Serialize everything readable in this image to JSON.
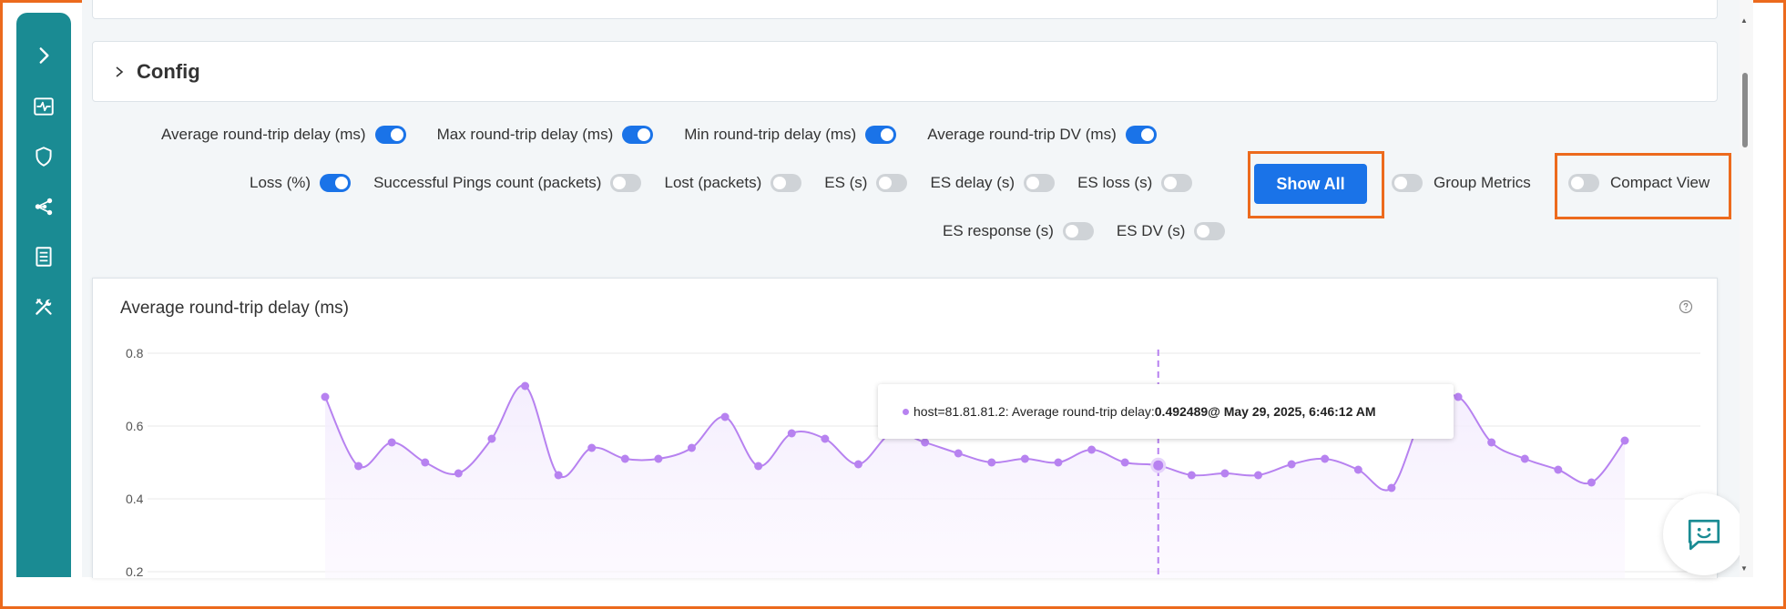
{
  "config": {
    "title": "Config"
  },
  "toggles": {
    "row1": [
      {
        "label": "Average round-trip delay (ms)",
        "on": true
      },
      {
        "label": "Max round-trip delay (ms)",
        "on": true
      },
      {
        "label": "Min round-trip delay (ms)",
        "on": true
      },
      {
        "label": "Average round-trip DV (ms)",
        "on": true
      }
    ],
    "row2": [
      {
        "label": "Loss (%)",
        "on": true
      },
      {
        "label": "Successful Pings count (packets)",
        "on": false
      },
      {
        "label": "Lost (packets)",
        "on": false
      },
      {
        "label": "ES (s)",
        "on": false
      },
      {
        "label": "ES delay (s)",
        "on": false
      },
      {
        "label": "ES loss (s)",
        "on": false
      }
    ],
    "row3": [
      {
        "label": "ES response (s)",
        "on": false
      },
      {
        "label": "ES DV (s)",
        "on": false
      }
    ]
  },
  "actions": {
    "show_all_label": "Show All",
    "group_metrics_label": "Group Metrics",
    "group_metrics_on": false,
    "compact_view_label": "Compact View",
    "compact_view_on": false
  },
  "chart": {
    "title": "Average round-trip delay (ms)",
    "tooltip": {
      "prefix": "host=81.81.81.2: Average round-trip delay: ",
      "value": "0.492489",
      "suffix": " @ May 29, 2025, 6:46:12 AM"
    },
    "colors": {
      "line": "#b782f0",
      "fill": "#f3ecfd",
      "crosshair": "#b782f0"
    }
  },
  "chart_data": {
    "type": "line",
    "title": "Average round-trip delay (ms)",
    "ylim": [
      0.2,
      0.8
    ],
    "yticks": [
      "0.8",
      "0.6",
      "0.4",
      "0.2"
    ],
    "series": [
      {
        "values": [
          0.68,
          0.49,
          0.555,
          0.5,
          0.47,
          0.565,
          0.71,
          0.465,
          0.54,
          0.51,
          0.51,
          0.54,
          0.625,
          0.49,
          0.58,
          0.565,
          0.495,
          0.58,
          0.555,
          0.525,
          0.5,
          0.51,
          0.5,
          0.535,
          0.5,
          0.492,
          0.465,
          0.47,
          0.465,
          0.495,
          0.51,
          0.48,
          0.43,
          0.64,
          0.68,
          0.555,
          0.51,
          0.48,
          0.445,
          0.56
        ]
      }
    ],
    "highlight_index": 25,
    "grid": true
  }
}
